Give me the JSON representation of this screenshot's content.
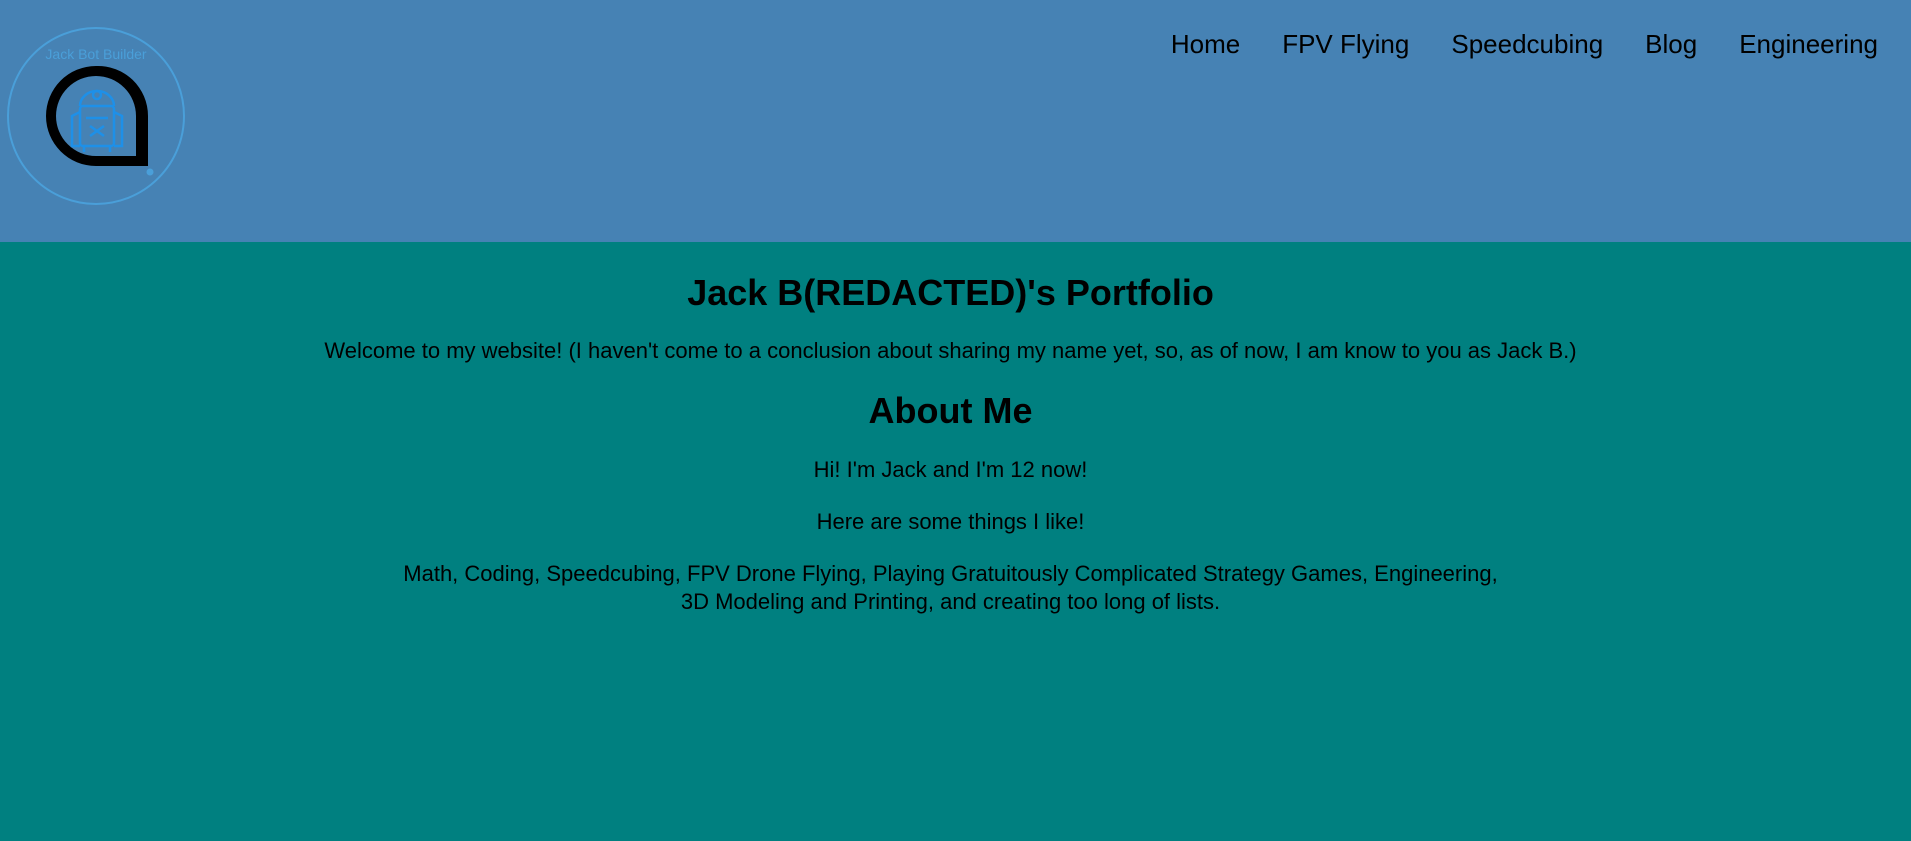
{
  "header": {
    "logo_text": "Jack Bot Builder",
    "nav": [
      {
        "label": "Home"
      },
      {
        "label": "FPV Flying"
      },
      {
        "label": "Speedcubing"
      },
      {
        "label": "Blog"
      },
      {
        "label": "Engineering"
      }
    ]
  },
  "main": {
    "title": "Jack B(REDACTED)'s Portfolio",
    "welcome": "Welcome to my website! (I haven't come to a conclusion about sharing my name yet, so, as of now, I am know to you as Jack B.)",
    "about_heading": "About Me",
    "intro": "Hi! I'm Jack and I'm 12 now!",
    "things_intro": "Here are some things I like!",
    "likes": "Math, Coding, Speedcubing, FPV Drone Flying, Playing Gratuitously Complicated Strategy Games, Engineering, 3D Modeling and Printing, and creating too long of lists."
  },
  "colors": {
    "header_bg": "#4682B4",
    "body_bg": "#008080",
    "logo_accent": "#4A9FD9"
  },
  "icons": {
    "logo": "robot-logo-icon"
  }
}
